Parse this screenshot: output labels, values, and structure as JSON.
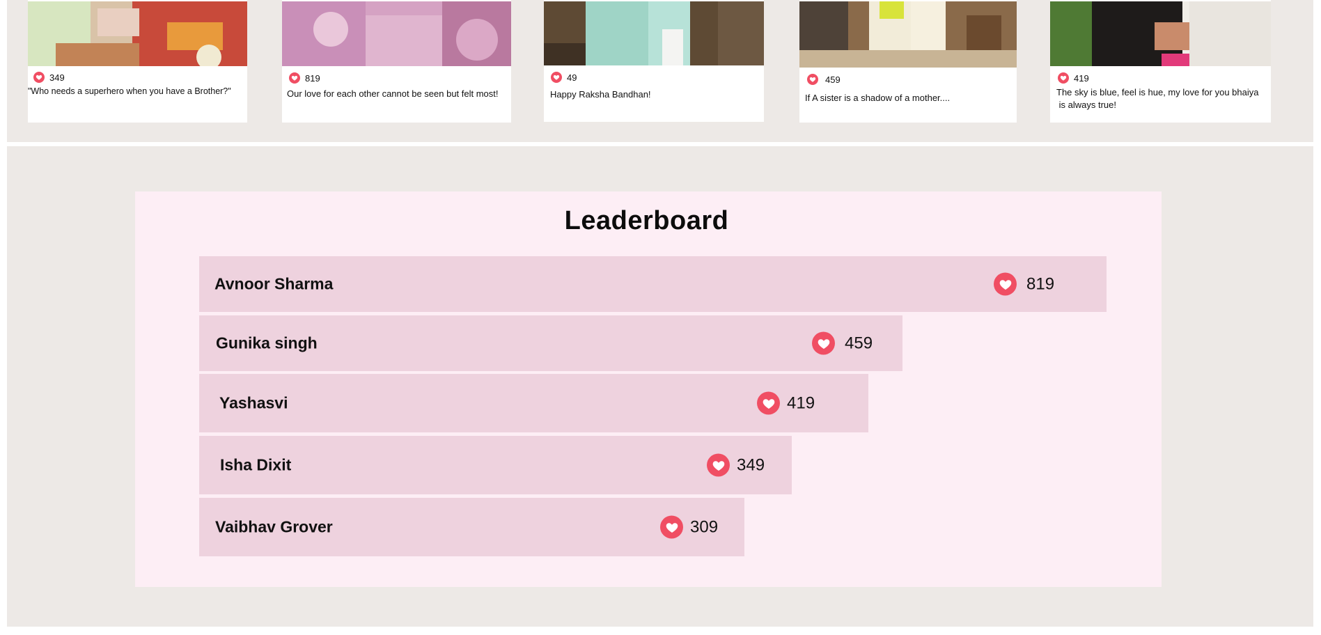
{
  "gallery": {
    "posts": [
      {
        "likes": "349",
        "caption": "\"Who needs a superhero when you have a Brother?\""
      },
      {
        "likes": "819",
        "caption": "Our love for each other cannot be seen but felt most!"
      },
      {
        "likes": "49",
        "caption": "Happy Raksha Bandhan!"
      },
      {
        "likes": "459",
        "caption": "If A sister is a shadow of a mother...."
      },
      {
        "likes": "419",
        "caption_line1": "The sky is blue, feel is hue, my love for you bhaiya",
        "caption_line2": " is always true!"
      }
    ]
  },
  "leaderboard": {
    "title": "Leaderboard",
    "entries": [
      {
        "name": "Avnoor Sharma",
        "likes": "819",
        "value": 819
      },
      {
        "name": "Gunika singh",
        "likes": "459",
        "value": 459
      },
      {
        "name": "Yashasvi",
        "likes": "419",
        "value": 419
      },
      {
        "name": "Isha Dixit",
        "likes": "349",
        "value": 349
      },
      {
        "name": "Vaibhav Grover",
        "likes": "309",
        "value": 309
      }
    ]
  },
  "colors": {
    "heart": "#f04e63",
    "band_background": "#ede9e6",
    "panel_background": "#fdeef5",
    "bar_fill": "#eed2de"
  },
  "icons": {
    "like": "heart-icon"
  }
}
